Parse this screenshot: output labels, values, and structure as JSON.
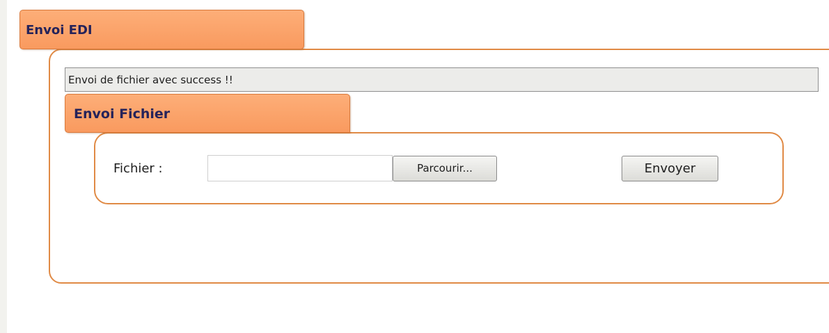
{
  "outer_section": {
    "title": "Envoi EDI"
  },
  "status": {
    "message": "Envoi de fichier avec success !!"
  },
  "upload_section": {
    "title": "Envoi Fichier",
    "file_label": "Fichier :",
    "file_input_value": "",
    "browse_label": "Parcourir...",
    "send_label": "Envoyer"
  },
  "colors": {
    "tab_fill": "#f99a5f",
    "panel_border": "#e08a45",
    "title_text": "#25235a",
    "message_bar": "#ececea"
  }
}
